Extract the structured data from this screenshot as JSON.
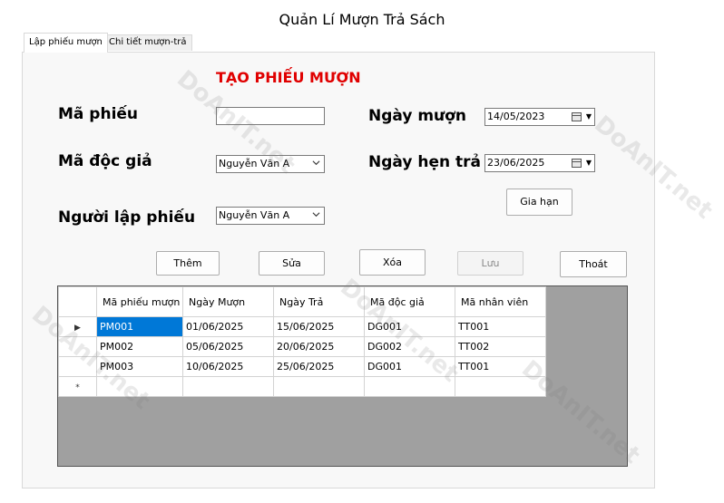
{
  "window": {
    "title": "Quản Lí Mượn Trả Sách"
  },
  "tabs": [
    {
      "label": "Lập phiếu mượn",
      "active": true
    },
    {
      "label": "Chi tiết mượn-trả",
      "active": false
    }
  ],
  "form": {
    "heading": "TẠO PHIẾU MƯỢN",
    "ma_phieu": {
      "label": "Mã phiếu",
      "value": ""
    },
    "ma_doc_gia": {
      "label": "Mã độc giả",
      "value": "Nguyễn Văn A"
    },
    "nguoi_lap_phieu": {
      "label": "Người lập phiếu",
      "value": "Nguyễn Văn A"
    },
    "ngay_muon": {
      "label": "Ngày mượn",
      "value": "14/05/2023"
    },
    "ngay_hen_tra": {
      "label": "Ngày hẹn trả",
      "value": "23/06/2025"
    },
    "gia_han_label": "Gia hạn"
  },
  "actions": {
    "them": "Thêm",
    "sua": "Sửa",
    "xoa": "Xóa",
    "luu": "Lưu",
    "thoat": "Thoát"
  },
  "grid": {
    "columns": [
      "Mã phiếu mượn",
      "Ngày Mượn",
      "Ngày Trả",
      "Mã độc giả",
      "Mã nhân viên"
    ],
    "rows": [
      [
        "PM001",
        "01/06/2025",
        "15/06/2025",
        "DG001",
        "TT001"
      ],
      [
        "PM002",
        "05/06/2025",
        "20/06/2025",
        "DG002",
        "TT002"
      ],
      [
        "PM003",
        "10/06/2025",
        "25/06/2025",
        "DG001",
        "TT001"
      ]
    ],
    "current_row_marker": "▶",
    "new_row_marker": "*"
  },
  "watermark": "DoAnIT.net",
  "colors": {
    "heading": "#e00000",
    "selection": "#0078d7",
    "grid_background": "#a0a0a0"
  }
}
